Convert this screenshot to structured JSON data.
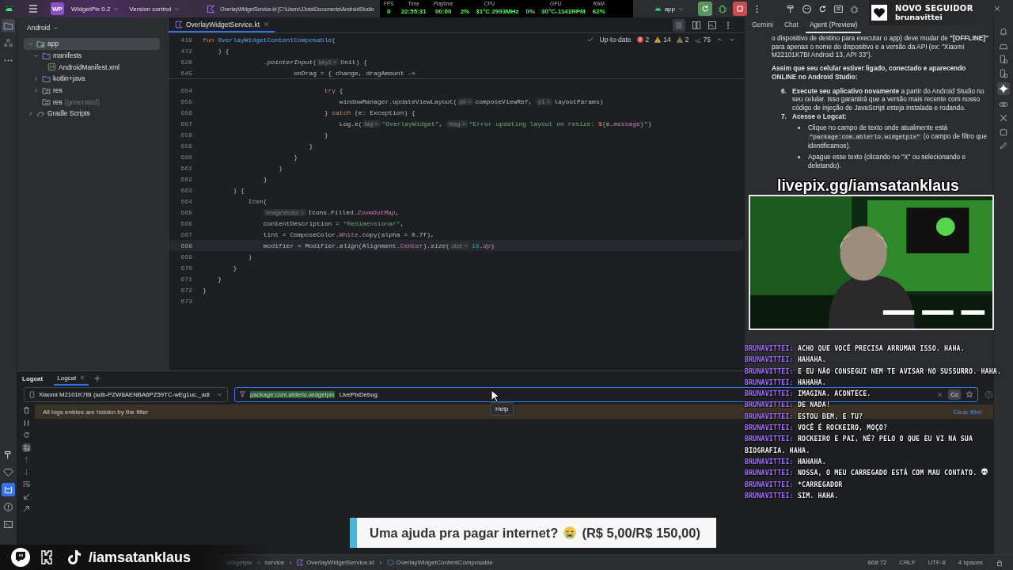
{
  "top_bar": {
    "project_badge": "WP",
    "project": "WidgetPix 0.2",
    "vcs": "Version control",
    "file_title": "OverlayWidgetService.kt [C:\\Users\\JJota\\Documents\\AndroidStudio",
    "run_config": "app"
  },
  "stats": [
    {
      "label": "FPS",
      "values": [
        "0"
      ]
    },
    {
      "label": "Time",
      "values": [
        "22:55:31"
      ]
    },
    {
      "label": "Playtime",
      "values": [
        "00:00"
      ]
    },
    {
      "label": "CPU",
      "values": [
        "2%",
        "31°C 2993MHz"
      ]
    },
    {
      "label": "GPU",
      "values": [
        "0%",
        "30°C-1141RPM"
      ]
    },
    {
      "label": "RAM",
      "values": [
        "62%"
      ]
    }
  ],
  "follower_alert": {
    "title": "NOVO SEGUIDOR",
    "user": "brunavittei"
  },
  "project": {
    "view": "Android",
    "tree": [
      {
        "label": "app",
        "kind": "module",
        "expanded": true,
        "selected": true,
        "children": [
          {
            "label": "manifests",
            "kind": "folder",
            "expanded": true,
            "selected": false,
            "children": [
              {
                "label": "AndroidManifest.xml",
                "kind": "manifest",
                "selected": false
              }
            ]
          },
          {
            "label": "kotlin+java",
            "kind": "folder",
            "expanded": false,
            "selected": false
          },
          {
            "label": "res",
            "kind": "res",
            "expanded": false,
            "selected": false
          },
          {
            "label": "res",
            "suffix": "(generated)",
            "kind": "res",
            "selected": false
          }
        ]
      },
      {
        "label": "Gradle Scripts",
        "kind": "gradle",
        "expanded": false,
        "selected": false
      }
    ]
  },
  "editor": {
    "tabs": [
      {
        "label": "OverlayWidgetService.kt",
        "selected": true
      }
    ],
    "status": "Up-to-date",
    "inspections": [
      {
        "kind": "error",
        "count": "2"
      },
      {
        "kind": "warning",
        "count": "14"
      },
      {
        "kind": "weak",
        "count": "2"
      },
      {
        "kind": "typo",
        "count": "75"
      }
    ],
    "sticky_lines": [
      {
        "num": "419",
        "tokens": [
          {
            "kind": "kw",
            "text": "fun "
          },
          {
            "kind": "fn",
            "text": "OverlayWidgetContentComposable"
          },
          {
            "kind": "p",
            "text": "("
          }
        ]
      },
      {
        "num": "472",
        "tokens": [
          {
            "kind": "p",
            "text": "    ) {"
          }
        ]
      },
      {
        "num": "628",
        "tokens": [
          {
            "kind": "ext",
            "text": "                .pointerInput"
          },
          {
            "kind": "p",
            "text": "("
          },
          {
            "kind": "hint",
            "text": "key1 ="
          },
          {
            "kind": "p",
            "text": "Unit) {"
          }
        ]
      },
      {
        "num": "645",
        "tokens": [
          {
            "kind": "p",
            "text": "                        onDrag = { change, dragAmount ->"
          }
        ]
      }
    ],
    "lines": [
      {
        "num": "654",
        "current": false,
        "tokens": [
          {
            "kind": "kw",
            "text": "                                try"
          },
          {
            "kind": "p",
            "text": " {"
          }
        ]
      },
      {
        "num": "655",
        "current": false,
        "tokens": [
          {
            "kind": "p",
            "text": "                                    windowManager.updateViewLayout("
          },
          {
            "kind": "hint",
            "text": "p0 ="
          },
          {
            "kind": "p",
            "text": "composeViewRef, "
          },
          {
            "kind": "hint",
            "text": "p1 ="
          },
          {
            "kind": "p",
            "text": "layoutParams)"
          }
        ]
      },
      {
        "num": "656",
        "current": false,
        "tokens": [
          {
            "kind": "p",
            "text": "                                } "
          },
          {
            "kind": "kw",
            "text": "catch"
          },
          {
            "kind": "p",
            "text": " (e: Exception) {"
          }
        ]
      },
      {
        "num": "657",
        "current": false,
        "tokens": [
          {
            "kind": "p",
            "text": "                                    Log.e("
          },
          {
            "kind": "hint",
            "text": "tag ="
          },
          {
            "kind": "str",
            "text": "\"OverlayWidget\""
          },
          {
            "kind": "p",
            "text": ", "
          },
          {
            "kind": "hint",
            "text": "msg ="
          },
          {
            "kind": "str",
            "text": "\"Error updating layout on resize: "
          },
          {
            "kind": "kw",
            "text": "${"
          },
          {
            "kind": "p",
            "text": "e."
          },
          {
            "kind": "prop",
            "text": "message"
          },
          {
            "kind": "kw",
            "text": "}"
          },
          {
            "kind": "str",
            "text": "\""
          },
          {
            "kind": "p",
            "text": ")"
          }
        ]
      },
      {
        "num": "658",
        "current": false,
        "tokens": [
          {
            "kind": "p",
            "text": "                                }"
          }
        ]
      },
      {
        "num": "659",
        "current": false,
        "tokens": [
          {
            "kind": "p",
            "text": "                            }"
          }
        ]
      },
      {
        "num": "660",
        "current": false,
        "tokens": [
          {
            "kind": "p",
            "text": "                        }"
          }
        ]
      },
      {
        "num": "661",
        "current": false,
        "tokens": [
          {
            "kind": "p",
            "text": "                    )"
          }
        ]
      },
      {
        "num": "662",
        "current": false,
        "tokens": [
          {
            "kind": "p",
            "text": "                }"
          }
        ]
      },
      {
        "num": "663",
        "current": false,
        "tokens": [
          {
            "kind": "p",
            "text": "        ) {"
          }
        ]
      },
      {
        "num": "664",
        "current": false,
        "tokens": [
          {
            "kind": "comp",
            "text": "            Icon"
          },
          {
            "kind": "p",
            "text": "("
          }
        ]
      },
      {
        "num": "665",
        "current": false,
        "tokens": [
          {
            "kind": "hint",
            "text": "imageVector ="
          },
          {
            "kind": "p",
            "text": "Icons.Filled."
          },
          {
            "kind": "propi",
            "text": "ZoomOutMap"
          },
          {
            "kind": "p",
            "text": ","
          }
        ]
      },
      {
        "num": "666",
        "current": false,
        "tokens": [
          {
            "kind": "p",
            "text": "                contentDescription = "
          },
          {
            "kind": "str",
            "text": "\"Redimensionar\""
          },
          {
            "kind": "p",
            "text": ","
          }
        ]
      },
      {
        "num": "667",
        "current": false,
        "tokens": [
          {
            "kind": "p",
            "text": "                tint = ComposeColor."
          },
          {
            "kind": "prop",
            "text": "White"
          },
          {
            "kind": "p",
            "text": ".copy(alpha = 0.7f),"
          }
        ]
      },
      {
        "num": "668",
        "current": true,
        "tokens": [
          {
            "kind": "p",
            "text": "                modifier = Modifier."
          },
          {
            "kind": "ext",
            "text": "align"
          },
          {
            "kind": "p",
            "text": "(Alignment."
          },
          {
            "kind": "prop",
            "text": "Center"
          },
          {
            "kind": "p",
            "text": ")."
          },
          {
            "kind": "ext",
            "text": "size"
          },
          {
            "kind": "p",
            "text": "("
          },
          {
            "kind": "hint",
            "text": "size ="
          },
          {
            "kind": "num",
            "text": "18"
          },
          {
            "kind": "p",
            "text": "."
          },
          {
            "kind": "propi",
            "text": "dp"
          },
          {
            "kind": "p",
            "text": ")"
          }
        ]
      },
      {
        "num": "669",
        "current": false,
        "tokens": [
          {
            "kind": "p",
            "text": "            )"
          }
        ]
      },
      {
        "num": "670",
        "current": false,
        "tokens": [
          {
            "kind": "p",
            "text": "        }"
          }
        ]
      },
      {
        "num": "671",
        "current": false,
        "tokens": [
          {
            "kind": "p",
            "text": "    }"
          }
        ]
      },
      {
        "num": "672",
        "current": false,
        "tokens": [
          {
            "kind": "p",
            "text": "}"
          }
        ]
      },
      {
        "num": "673",
        "current": false
      }
    ]
  },
  "assistant": {
    "tabs": [
      {
        "label": "Gemini",
        "selected": false
      },
      {
        "label": "Chat",
        "selected": false
      },
      {
        "label": "Agent (Preview)",
        "selected": true
      }
    ],
    "blocks": [
      {
        "kind": "paragraph",
        "text": "o dispositivo de destino para executar o app) deve mudar de **\"[OFFLINE]\"** para apenas o nome do dispositivo e a versão da API (ex: \"Xiaomi M22101K7BI Android 13, API 33\")."
      },
      {
        "kind": "heading",
        "text": "Assim que seu celular estiver ligado, conectado e aparecendo ONLINE no Android Studio:"
      },
      {
        "kind": "step",
        "number": "6.",
        "bold": false,
        "text": "**Execute seu aplicativo novamente** a partir do Android Studio no seu celular. Isso garantirá que a versão mais recente com nosso código de injeção de JavaScript esteja instalada e rodando."
      },
      {
        "kind": "step",
        "number": "7.",
        "bold": true,
        "text": "Acesse o Logcat:"
      },
      {
        "kind": "bullet",
        "before": "Clique no campo de texto onde atualmente está ",
        "code": "\"package:com.ablerlo.widgetpix\"",
        "after": " (o campo de filtro que identificamos)."
      },
      {
        "kind": "bullet",
        "text": "Apague esse texto (clicando no \"X\" ou selecionando e deletando)."
      }
    ]
  },
  "livepix_banner": "livepix.gg/iamsatanklaus",
  "chat": [
    {
      "user": "BRUNAVITTEI:",
      "message": "ACHO QUE VOCÊ PRECISA ARRUMAR ISSO. HAHA."
    },
    {
      "user": "BRUNAVITTEI:",
      "message": "HAHAHA."
    },
    {
      "user": "BRUNAVITTEI:",
      "message": "E EU NÃO CONSEGUI NEM TE AVISAR NO SUSSURRO. HAHA."
    },
    {
      "user": "BRUNAVITTEI:",
      "message": "HAHAHA."
    },
    {
      "user": "BRUNAVITTEI:",
      "message": "IMAGINA. ACONTECE."
    },
    {
      "user": "BRUNAVITTEI:",
      "message": "DE NADA!"
    },
    {
      "user": "BRUNAVITTEI:",
      "message": "ESTOU BEM, E TU?"
    },
    {
      "user": "BRUNAVITTEI:",
      "message": "VOCÊ É ROCKEIRO, MOÇO?"
    },
    {
      "user": "BRUNAVITTEI:",
      "message": "ROCKEIRO E PAI, NÉ? PELO O QUE EU VI NA SUA BIOGRAFIA. HAHA."
    },
    {
      "user": "BRUNAVITTEI:",
      "message": "HAHAHA."
    },
    {
      "user": "BRUNAVITTEI:",
      "message": "NOSSA, O MEU CARREGADO ESTÁ COM MAU CONTATO.",
      "kind": "skull_emote"
    },
    {
      "user": "BRUNAVITTEI:",
      "message": "*CARREGADOR"
    },
    {
      "user": "BRUNAVITTEI:",
      "message": "SIM. HAHA."
    }
  ],
  "logcat": {
    "title": "Logcat",
    "tabs": [
      {
        "label": "Logcat",
        "selected": true,
        "closable": true
      }
    ],
    "device": "Xiaomi M2101K7BI (adb-PZW8AENBA6PZ59TC-wEg1uc._adl",
    "filter": {
      "selected_text": "package:com.ablerlo.widgetpix",
      "text": " LivePixDebug",
      "case_toggle": "Cc"
    },
    "tooltip": "Help",
    "notice": "All logs entries are hidden by the filter",
    "clear_action": "Clear filter"
  },
  "donation": {
    "text": "Uma ajuda pra pagar internet?",
    "amount": "(R$ 5,00/R$ 150,00)"
  },
  "social": {
    "handle": "/iamsatanklaus"
  },
  "status_bar": {
    "breadcrumbs": [
      {
        "kind": "package",
        "label": "widgetpix"
      },
      {
        "kind": "package",
        "label": "service"
      },
      {
        "kind": "file",
        "label": "OverlayWidgetService.kt"
      },
      {
        "kind": "function",
        "label": "OverlayWidgetContentComposable"
      }
    ],
    "items": [
      "668:72",
      "CRLF",
      "UTF-8",
      "4 spaces"
    ]
  }
}
